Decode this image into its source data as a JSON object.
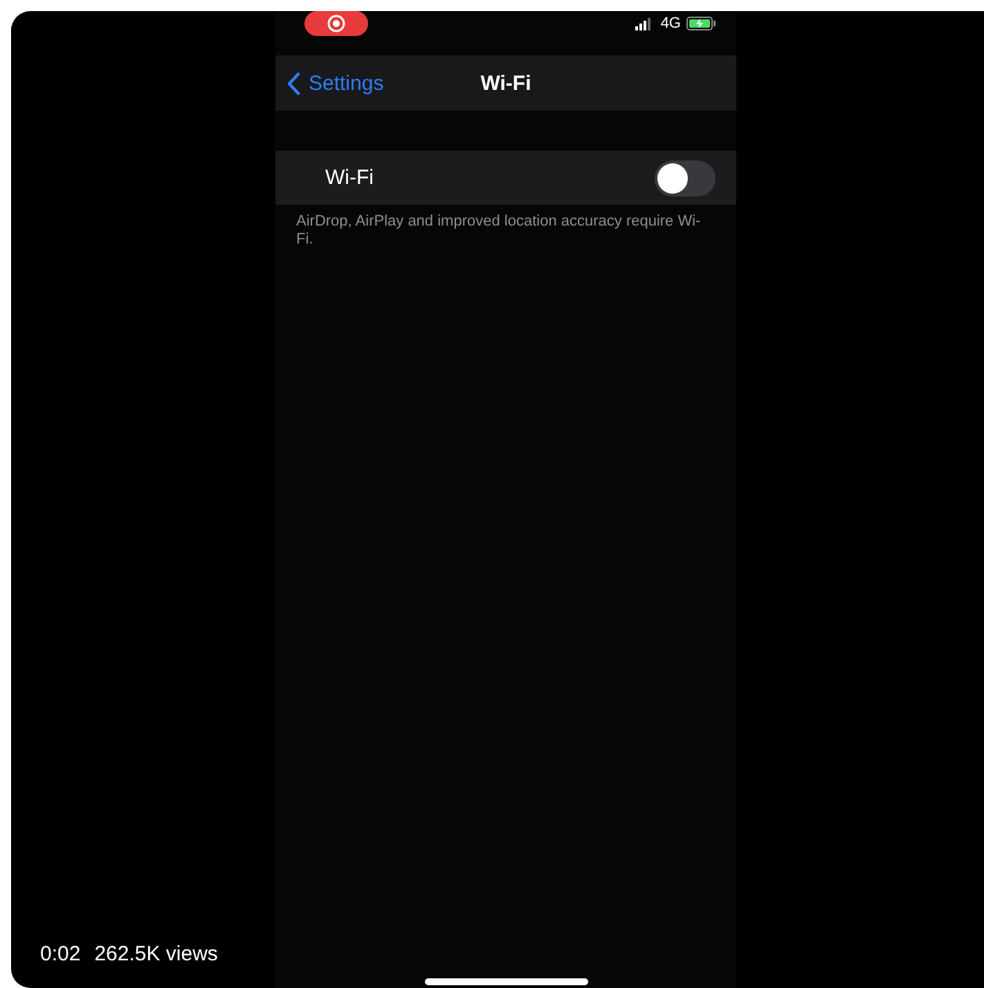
{
  "status_bar": {
    "recording": true,
    "network": "4G",
    "charging": true
  },
  "nav_bar": {
    "back": "Settings",
    "title": "Wi-Fi"
  },
  "settings": [
    {
      "label": "Wi-Fi",
      "on": false
    }
  ],
  "footer": "AirDrop, AirPlay and improved location accuracy require Wi-Fi.",
  "video": {
    "time": "0:02",
    "views": "262.5K views"
  }
}
